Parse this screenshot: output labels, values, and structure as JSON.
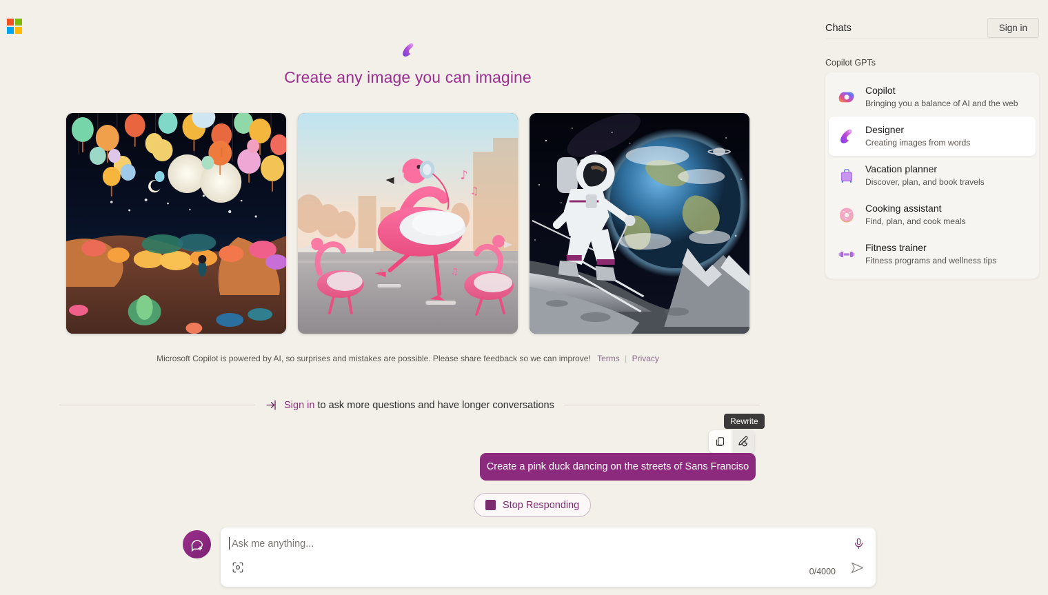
{
  "brand": {
    "logo_name": "microsoft-logo",
    "logo_colors": [
      "#f25022",
      "#7fba00",
      "#00a4ef",
      "#ffb900"
    ],
    "accent": "#8c2a7d",
    "title_color": "#9b2f8f",
    "background": "#f3f0ea"
  },
  "hero": {
    "logo_name": "designer-logo",
    "title": "Create any image you can imagine"
  },
  "gallery": {
    "items": [
      {
        "name": "sample-image-lantern-garden",
        "alt": "Glowing paper lanterns hanging over a colorful illuminated flower garden at night with a child and two moons"
      },
      {
        "name": "sample-image-dancing-flamingos",
        "alt": "Pink flamingos wearing headphones dancing on a city street at sunrise with music notes"
      },
      {
        "name": "sample-image-astronaut-skiing",
        "alt": "Astronaut skiing down a lunar slope with planet Earth rising in the starry sky"
      }
    ]
  },
  "disclaimer": {
    "text": "Microsoft Copilot is powered by AI, so surprises and mistakes are possible. Please share feedback so we can improve!",
    "terms_label": "Terms",
    "separator": "|",
    "privacy_label": "Privacy"
  },
  "signin_prompt": {
    "icon": "sign-in-arrow-icon",
    "link_label": "Sign in",
    "rest_text": " to ask more questions and have longer conversations"
  },
  "message_actions": {
    "tooltip": "Rewrite",
    "copy_icon": "copy-icon",
    "copy_label": "Copy",
    "rewrite_icon": "rewrite-pencil-icon",
    "rewrite_label": "Rewrite"
  },
  "conversation": {
    "user_message": "Create a pink duck dancing on the streets of Sans Franciso"
  },
  "stop_button": {
    "icon": "stop-square-icon",
    "label": "Stop Responding"
  },
  "composer": {
    "new_chat_icon": "new-chat-icon",
    "placeholder": "Ask me anything...",
    "value": "",
    "scan_icon": "visual-search-icon",
    "mic_icon": "microphone-icon",
    "send_icon": "send-icon",
    "counter": "0/4000"
  },
  "panel": {
    "title": "Chats",
    "signin_label": "Sign in",
    "section_label": "Copilot GPTs",
    "items": [
      {
        "icon": "copilot-icon",
        "name": "Copilot",
        "desc": "Bringing you a balance of AI and the web",
        "selected": false
      },
      {
        "icon": "designer-icon",
        "name": "Designer",
        "desc": "Creating images from words",
        "selected": true
      },
      {
        "icon": "suitcase-icon",
        "name": "Vacation planner",
        "desc": "Discover, plan, and book travels",
        "selected": false
      },
      {
        "icon": "donut-icon",
        "name": "Cooking assistant",
        "desc": "Find, plan, and cook meals",
        "selected": false
      },
      {
        "icon": "dumbbell-icon",
        "name": "Fitness trainer",
        "desc": "Fitness programs and wellness tips",
        "selected": false
      }
    ]
  }
}
